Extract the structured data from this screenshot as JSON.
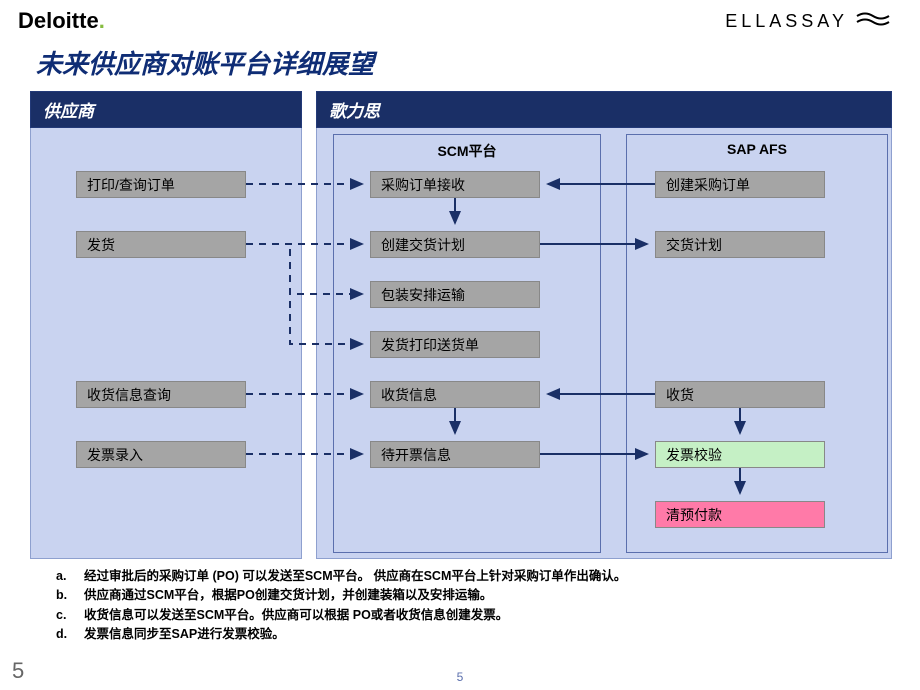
{
  "logos": {
    "deloitte": "Deloitte",
    "ellassay": "ELLASSAY"
  },
  "title": "未来供应商对账平台详细展望",
  "columns": {
    "supplier": "供应商",
    "gelisi": "歌力思"
  },
  "subPanels": {
    "scm": "SCM平台",
    "sap": "SAP AFS"
  },
  "boxes": {
    "s1": "打印/查询订单",
    "s2": "发货",
    "s3": "收货信息查询",
    "s4": "发票录入",
    "m1": "采购订单接收",
    "m2": "创建交货计划",
    "m3": "包装安排运输",
    "m4": "发货打印送货单",
    "m5": "收货信息",
    "m6": "待开票信息",
    "r1": "创建采购订单",
    "r2": "交货计划",
    "r3": "收货",
    "r4": "发票校验",
    "r5": "清预付款"
  },
  "notes": {
    "a": {
      "lbl": "a.",
      "txt": "经过审批后的采购订单 (PO) 可以发送至SCM平台。 供应商在SCM平台上针对采购订单作出确认。"
    },
    "b": {
      "lbl": "b.",
      "txt": "供应商通过SCM平台，根据PO创建交货计划，并创建装箱以及安排运输。"
    },
    "c": {
      "lbl": "c.",
      "txt": "收货信息可以发送至SCM平台。供应商可以根据 PO或者收货信息创建发票。"
    },
    "d": {
      "lbl": "d.",
      "txt": "发票信息同步至SAP进行发票校验。"
    }
  },
  "pageLeft": "5",
  "pageCenter": "5"
}
